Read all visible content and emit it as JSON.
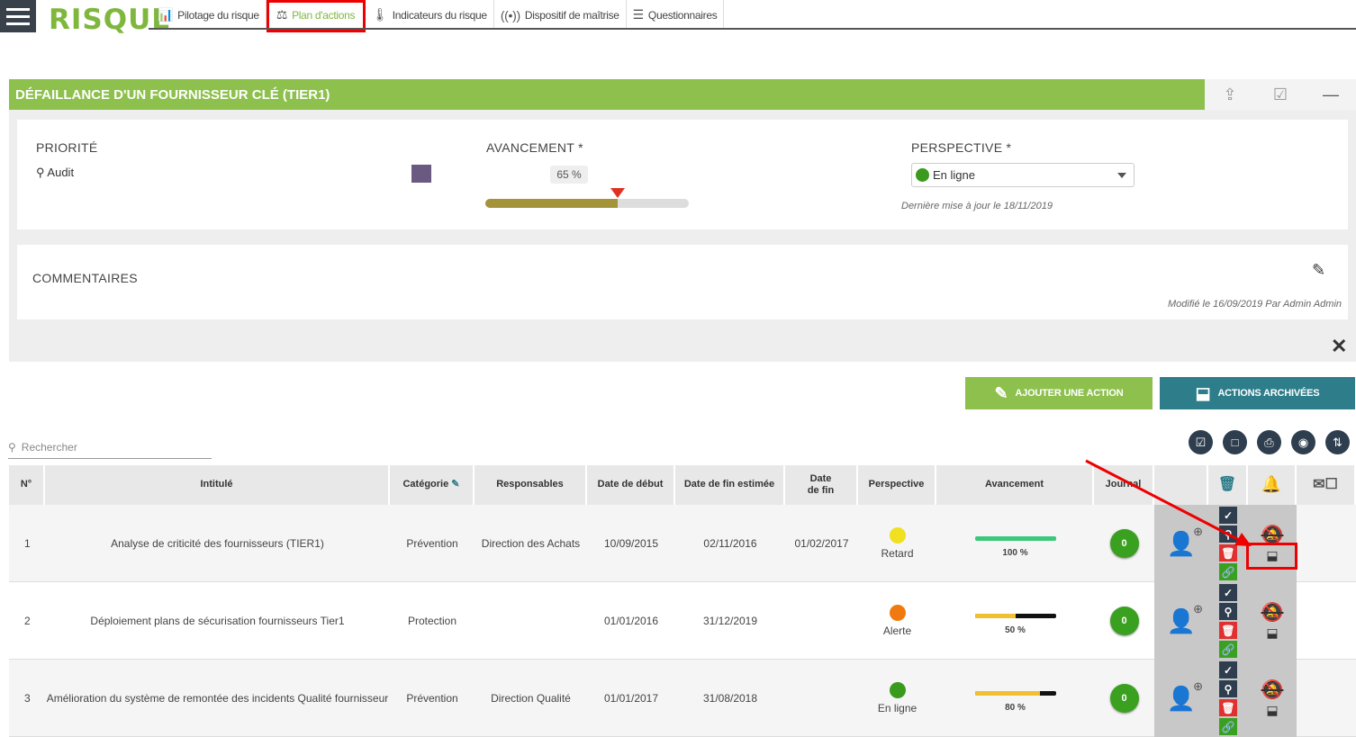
{
  "app": {
    "logo": "RISQUE"
  },
  "nav": [
    {
      "icon": "chart-icon",
      "glyph": "📊",
      "label": "Pilotage du risque"
    },
    {
      "icon": "people-icon",
      "glyph": "⚖",
      "label": "Plan d'actions"
    },
    {
      "icon": "thermometer-icon",
      "glyph": "🌡",
      "label": "Indicateurs du risque"
    },
    {
      "icon": "signal-icon",
      "glyph": "((•))",
      "label": "Dispositif de maîtrise"
    },
    {
      "icon": "list-icon",
      "glyph": "☰",
      "label": "Questionnaires"
    }
  ],
  "risk": {
    "title": "DÉFAILLANCE D'UN FOURNISSEUR CLÉ (TIER1)",
    "priority_label": "PRIORITÉ",
    "priority_value": "Audit",
    "priority_color": "#6a5a82",
    "progress_label": "AVANCEMENT *",
    "progress_value": "65 %",
    "progress_fraction": 0.65,
    "perspective_label": "PERSPECTIVE *",
    "perspective_value": "En ligne",
    "last_update": "Dernière mise à jour le 18/11/2019",
    "comments_label": "COMMENTAIRES",
    "modified": "Modifié le 16/09/2019 Par Admin Admin"
  },
  "buttons": {
    "add_action": "AJOUTER UNE ACTION",
    "archived": "ACTIONS ARCHIVÉES"
  },
  "search": {
    "placeholder": "Rechercher"
  },
  "table": {
    "headers": {
      "num": "N°",
      "title": "Intitulé",
      "category": "Catégorie",
      "owners": "Responsables",
      "start": "Date de début",
      "est_end": "Date de fin estimée",
      "end": "Date de fin",
      "perspective": "Perspective",
      "progress": "Avancement",
      "journal": "Journal"
    },
    "rows": [
      {
        "num": "1",
        "title": "Analyse de criticité des fournisseurs (TIER1)",
        "category": "Prévention",
        "owners": "Direction des Achats",
        "start": "10/09/2015",
        "est_end": "02/11/2016",
        "end": "01/02/2017",
        "perspective": "Retard",
        "persp_color": "#f0e020",
        "progress": "100 %",
        "progress_fraction": 1.0,
        "bar_color": "#3cc87a",
        "journal": "0"
      },
      {
        "num": "2",
        "title": "Déploiement plans de sécurisation fournisseurs Tier1",
        "category": "Protection",
        "owners": "",
        "start": "01/01/2016",
        "est_end": "31/12/2019",
        "end": "",
        "perspective": "Alerte",
        "persp_color": "#f07a10",
        "progress": "50 %",
        "progress_fraction": 0.5,
        "bar_color": "#f0c030",
        "journal": "0"
      },
      {
        "num": "3",
        "title": "Amélioration du système de remontée des incidents Qualité fournisseur",
        "category": "Prévention",
        "owners": "Direction Qualité",
        "start": "01/01/2017",
        "est_end": "31/08/2018",
        "end": "",
        "perspective": "En ligne",
        "persp_color": "#3a9a1e",
        "progress": "80 %",
        "progress_fraction": 0.8,
        "bar_color": "#f0c030",
        "journal": "0"
      }
    ]
  },
  "colors": {
    "accent_green": "#8dc04c",
    "teal": "#2d7d8a",
    "dark": "#2f3e4e",
    "highlight_red": "#e00000"
  }
}
